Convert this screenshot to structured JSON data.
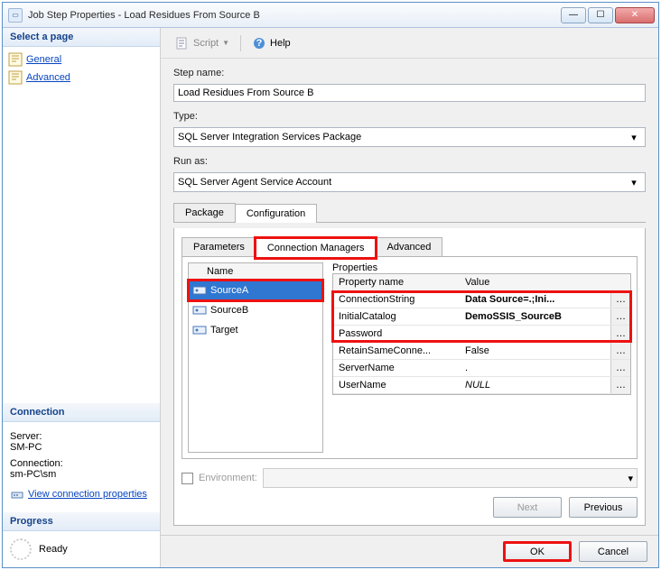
{
  "window": {
    "title": "Job Step Properties - Load Residues From Source B",
    "icon_label": "app-icon"
  },
  "left": {
    "select_page": "Select a page",
    "pages": [
      "General",
      "Advanced"
    ],
    "connection_hdr": "Connection",
    "server_lbl": "Server:",
    "server_val": "SM-PC",
    "conn_lbl": "Connection:",
    "conn_val": "sm-PC\\sm",
    "view_conn": "View connection properties",
    "progress_hdr": "Progress",
    "progress_state": "Ready"
  },
  "toolbar": {
    "script": "Script",
    "help": "Help"
  },
  "form": {
    "stepname_lbl": "Step name:",
    "stepname_val": "Load Residues From Source B",
    "type_lbl": "Type:",
    "type_val": "SQL Server Integration Services Package",
    "runas_lbl": "Run as:",
    "runas_val": "SQL Server Agent Service Account"
  },
  "tabs": {
    "outer": [
      "Package",
      "Configuration"
    ],
    "inner": [
      "Parameters",
      "Connection Managers",
      "Advanced"
    ]
  },
  "cm": {
    "header": "Name",
    "items": [
      "SourceA",
      "SourceB",
      "Target"
    ]
  },
  "props": {
    "label": "Properties",
    "cols": [
      "Property name",
      "Value"
    ],
    "rows": [
      {
        "name": "ConnectionString",
        "value": "Data Source=.;Ini...",
        "bold": true,
        "btn": true
      },
      {
        "name": "InitialCatalog",
        "value": "DemoSSIS_SourceB",
        "bold": true,
        "btn": true
      },
      {
        "name": "Password",
        "value": "",
        "bold": false,
        "btn": true
      },
      {
        "name": "RetainSameConne...",
        "value": "False",
        "bold": false,
        "btn": true
      },
      {
        "name": "ServerName",
        "value": ".",
        "bold": false,
        "btn": true
      },
      {
        "name": "UserName",
        "value": "NULL",
        "bold": false,
        "btn": true,
        "italic": true
      }
    ]
  },
  "env_label": "Environment:",
  "nav": {
    "next": "Next",
    "prev": "Previous"
  },
  "footer": {
    "ok": "OK",
    "cancel": "Cancel"
  }
}
